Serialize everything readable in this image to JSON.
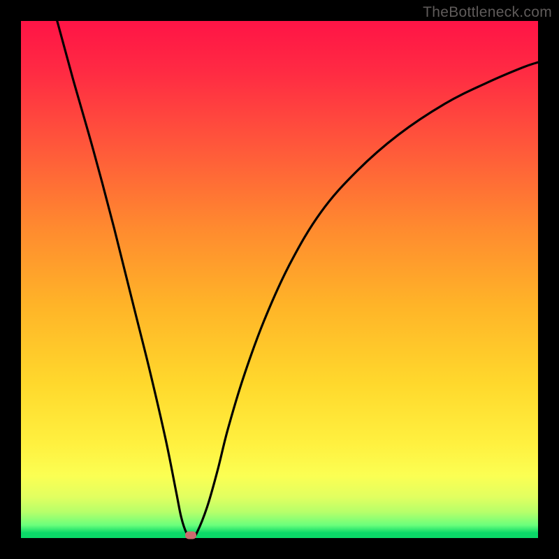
{
  "watermark": "TheBottleneck.com",
  "chart_data": {
    "type": "line",
    "title": "",
    "xlabel": "",
    "ylabel": "",
    "xlim": [
      0,
      100
    ],
    "ylim": [
      0,
      100
    ],
    "series": [
      {
        "name": "curve",
        "x": [
          7,
          10,
          14,
          18,
          22,
          25,
          28,
          30,
          31,
          32,
          33,
          34,
          36,
          38,
          40,
          43,
          47,
          52,
          58,
          65,
          73,
          82,
          90,
          97,
          100
        ],
        "y": [
          100,
          89,
          75,
          60,
          44,
          32,
          19,
          9,
          4,
          1,
          0,
          1,
          6,
          13,
          21,
          31,
          42,
          53,
          63,
          71,
          78,
          84,
          88,
          91,
          92
        ]
      }
    ],
    "marker": {
      "x_pct": 32.8,
      "y_bottom_pct": 0.6,
      "color": "#cd6a6e"
    }
  }
}
